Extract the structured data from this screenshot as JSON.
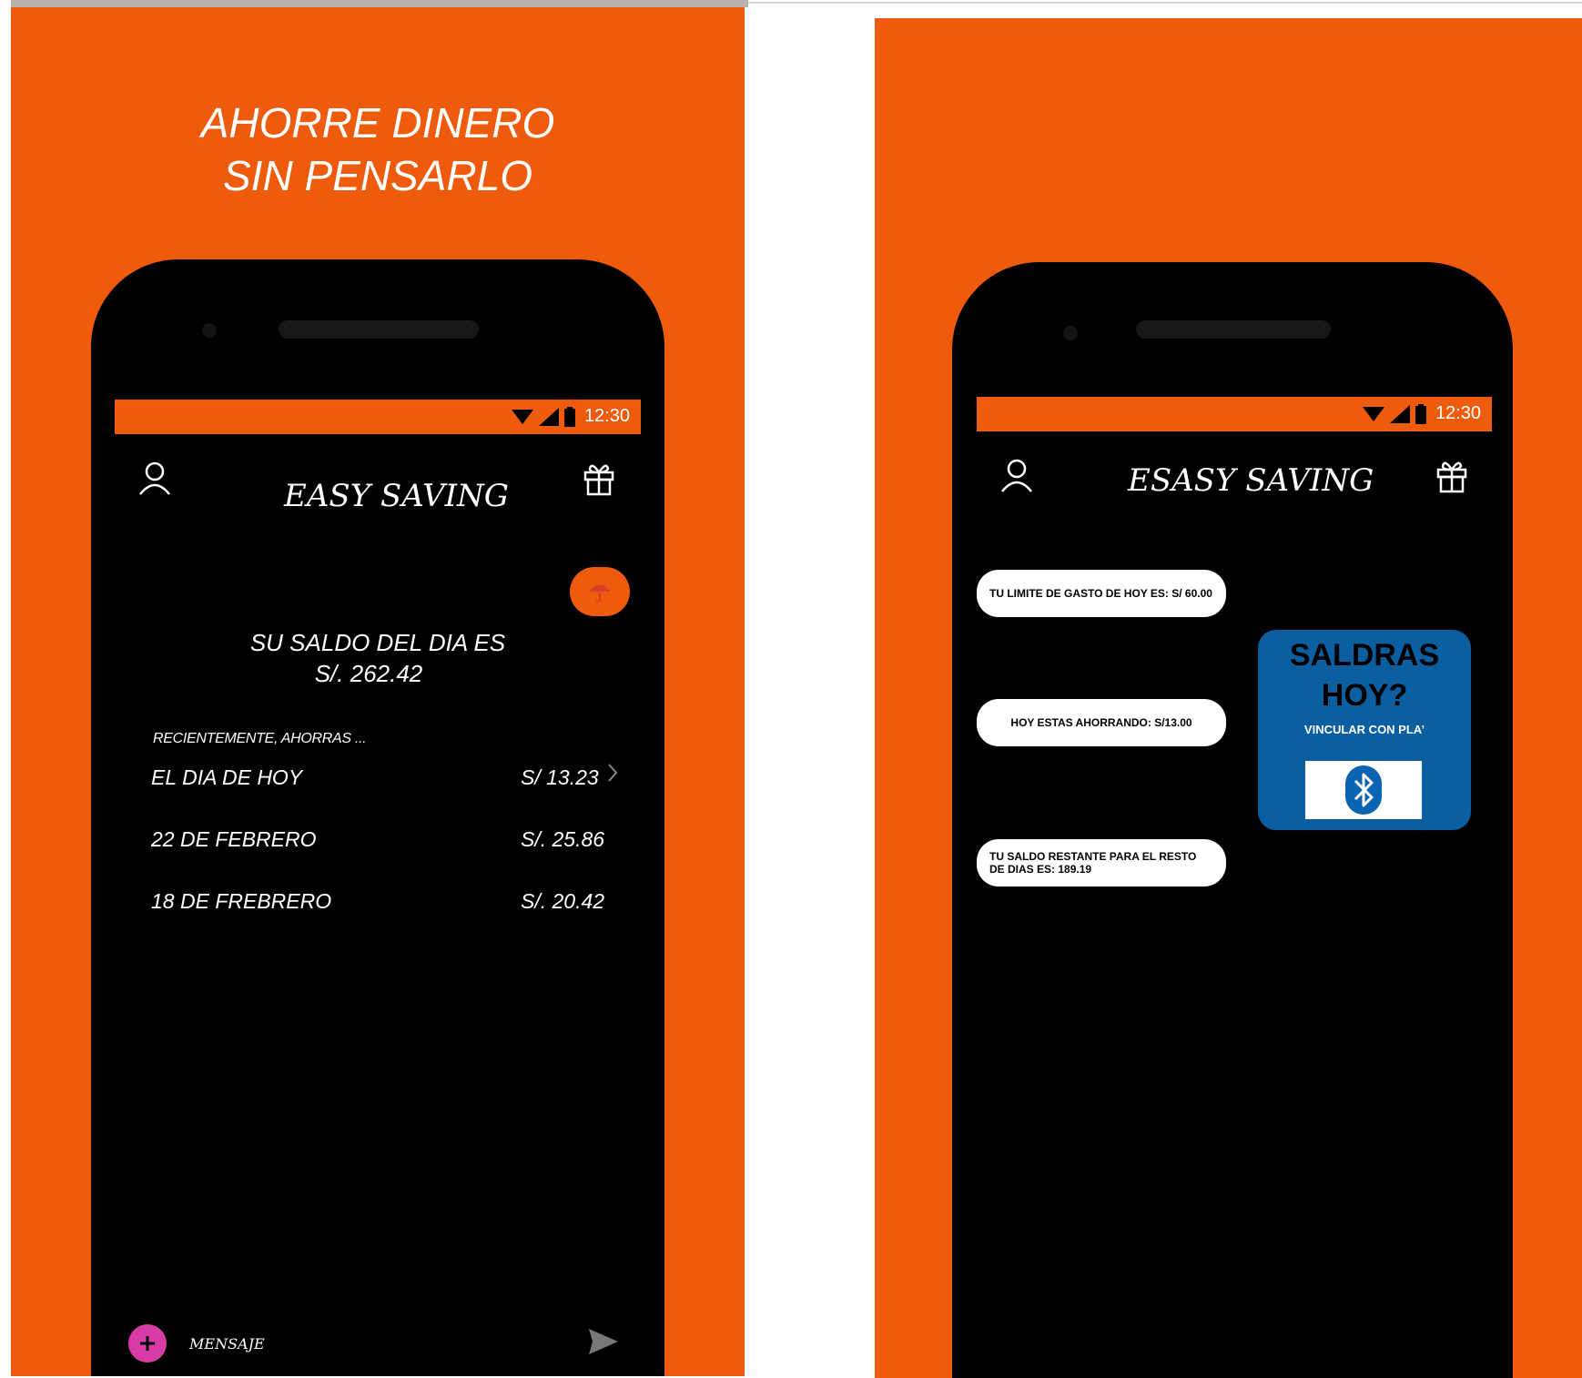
{
  "left": {
    "tagline": [
      "AHORRE DINERO",
      "SIN PENSARLO"
    ],
    "status_time": "12:30",
    "app_title": "EASY SAVING",
    "balance_line1": "SU SALDO DEL DIA ES",
    "balance_line2": "S/. 262.42",
    "recent_label": "RECIENTEMENTE, AHORRAS ...",
    "savings": [
      {
        "label": "EL DIA DE HOY",
        "amount": "S/ 13.23"
      },
      {
        "label": "22 DE FEBRERO",
        "amount": "S/. 25.86"
      },
      {
        "label": "18 DE FREBRERO",
        "amount": "S/. 20.42"
      }
    ],
    "message_placeholder": "MENSAJE"
  },
  "right": {
    "status_time": "12:30",
    "app_title": "ESASY SAVING",
    "bubbles": [
      "TU LIMITE DE GASTO DE HOY ES: S/ 60.00",
      "HOY ESTAS AHORRANDO: S/13.00",
      "TU SALDO RESTANTE PARA EL RESTO DE DIAS ES: 189.19"
    ],
    "card_title_line1": "SALDRAS",
    "card_title_line2": "HOY?",
    "card_subtitle": "VINCULAR CON PLA’"
  },
  "colors": {
    "accent": "#ee5b0c",
    "card": "#0b5fa0",
    "fab_pink": "#d63ba6",
    "bluetooth": "#0a64b4"
  }
}
